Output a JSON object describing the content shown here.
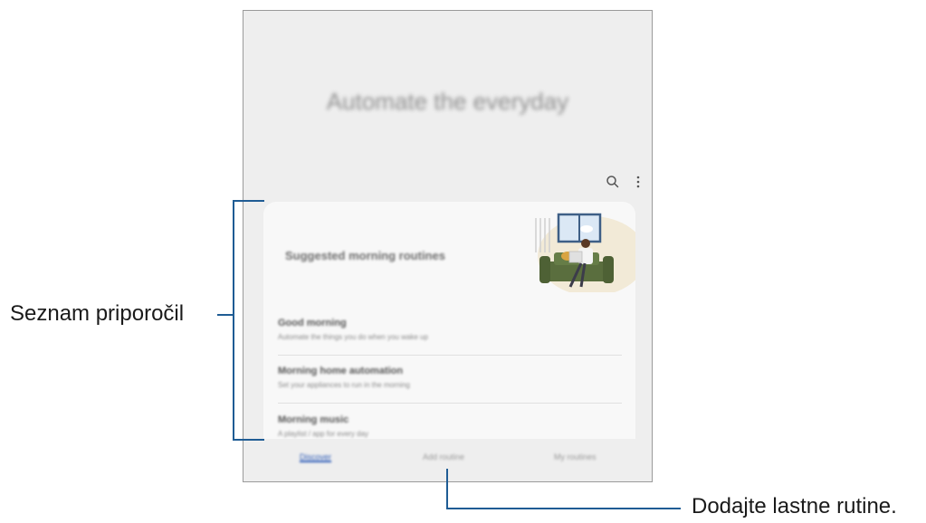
{
  "screen": {
    "hero_title": "Automate the everyday",
    "toolbar": {
      "search_icon": "search-icon",
      "more_icon": "more-vertical-icon"
    },
    "suggestions_card": {
      "title": "Suggested morning routines",
      "items": [
        {
          "title": "Good morning",
          "description": "Automate the things you do when you wake up"
        },
        {
          "title": "Morning home automation",
          "description": "Set your appliances to run in the morning"
        },
        {
          "title": "Morning music",
          "description": "A playlist / app for every day"
        }
      ]
    },
    "tabs": [
      {
        "label": "Discover",
        "active": true
      },
      {
        "label": "Add routine",
        "active": false
      },
      {
        "label": "My routines",
        "active": false
      }
    ]
  },
  "callouts": {
    "recommendations_list": "Seznam priporočil",
    "add_own_routines": "Dodajte lastne rutine."
  },
  "colors": {
    "accent": "#2f5db8",
    "callout_line": "#1f5c94"
  }
}
